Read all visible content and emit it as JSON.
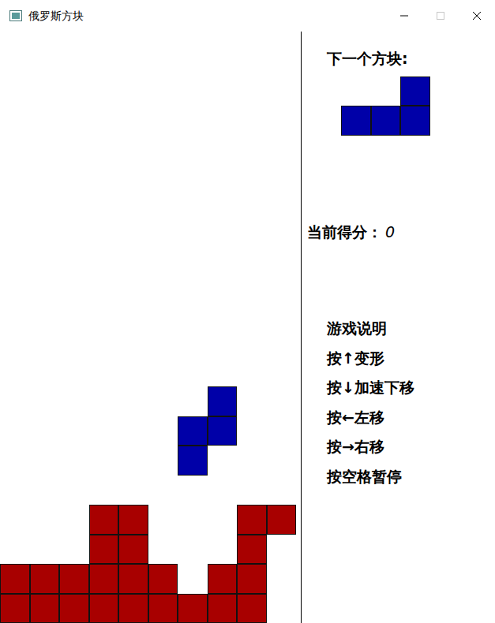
{
  "window": {
    "title": "俄罗斯方块",
    "maximize_disabled": true
  },
  "kinds": {
    "locked": {
      "color": "#a80000"
    },
    "falling": {
      "color": "#0000a8"
    }
  },
  "board": {
    "rows": [
      [
        "empty",
        "empty",
        "empty",
        "empty",
        "empty",
        "empty",
        "empty",
        "empty",
        "empty",
        "empty"
      ],
      [
        "empty",
        "empty",
        "empty",
        "empty",
        "empty",
        "empty",
        "empty",
        "empty",
        "empty",
        "empty"
      ],
      [
        "empty",
        "empty",
        "empty",
        "empty",
        "empty",
        "empty",
        "empty",
        "empty",
        "empty",
        "empty"
      ],
      [
        "empty",
        "empty",
        "empty",
        "empty",
        "empty",
        "empty",
        "empty",
        "empty",
        "empty",
        "empty"
      ],
      [
        "empty",
        "empty",
        "empty",
        "empty",
        "empty",
        "empty",
        "empty",
        "empty",
        "empty",
        "empty"
      ],
      [
        "empty",
        "empty",
        "empty",
        "empty",
        "empty",
        "empty",
        "empty",
        "empty",
        "empty",
        "empty"
      ],
      [
        "empty",
        "empty",
        "empty",
        "empty",
        "empty",
        "empty",
        "empty",
        "empty",
        "empty",
        "empty"
      ],
      [
        "empty",
        "empty",
        "empty",
        "empty",
        "empty",
        "empty",
        "empty",
        "empty",
        "empty",
        "empty"
      ],
      [
        "empty",
        "empty",
        "empty",
        "empty",
        "empty",
        "empty",
        "empty",
        "empty",
        "empty",
        "empty"
      ],
      [
        "empty",
        "empty",
        "empty",
        "empty",
        "empty",
        "empty",
        "empty",
        "empty",
        "empty",
        "empty"
      ],
      [
        "empty",
        "empty",
        "empty",
        "empty",
        "empty",
        "empty",
        "empty",
        "empty",
        "empty",
        "empty"
      ],
      [
        "empty",
        "empty",
        "empty",
        "empty",
        "empty",
        "empty",
        "empty",
        "empty",
        "empty",
        "empty"
      ],
      [
        "empty",
        "empty",
        "empty",
        "empty",
        "empty",
        "empty",
        "empty",
        "falling",
        "empty",
        "empty"
      ],
      [
        "empty",
        "empty",
        "empty",
        "empty",
        "empty",
        "empty",
        "falling",
        "falling",
        "empty",
        "empty"
      ],
      [
        "empty",
        "empty",
        "empty",
        "empty",
        "empty",
        "empty",
        "falling",
        "empty",
        "empty",
        "empty"
      ],
      [
        "empty",
        "empty",
        "empty",
        "empty",
        "empty",
        "empty",
        "empty",
        "empty",
        "empty",
        "empty"
      ],
      [
        "empty",
        "empty",
        "empty",
        "locked",
        "locked",
        "empty",
        "empty",
        "empty",
        "locked",
        "locked"
      ],
      [
        "empty",
        "empty",
        "empty",
        "locked",
        "locked",
        "empty",
        "empty",
        "empty",
        "locked",
        "empty"
      ],
      [
        "locked",
        "locked",
        "locked",
        "locked",
        "locked",
        "locked",
        "empty",
        "locked",
        "locked",
        "empty"
      ],
      [
        "locked",
        "locked",
        "locked",
        "locked",
        "locked",
        "locked",
        "locked",
        "locked",
        "locked",
        "empty"
      ]
    ]
  },
  "next_piece": {
    "label": "下一个方块:",
    "rows": [
      [
        "empty",
        "empty",
        "falling"
      ],
      [
        "falling",
        "falling",
        "falling"
      ]
    ]
  },
  "score": {
    "label": "当前得分：",
    "value": "0"
  },
  "help": {
    "title": "游戏说明",
    "lines": [
      "按↑变形",
      "按↓加速下移",
      "按←左移",
      "按→右移",
      "按空格暂停"
    ]
  }
}
